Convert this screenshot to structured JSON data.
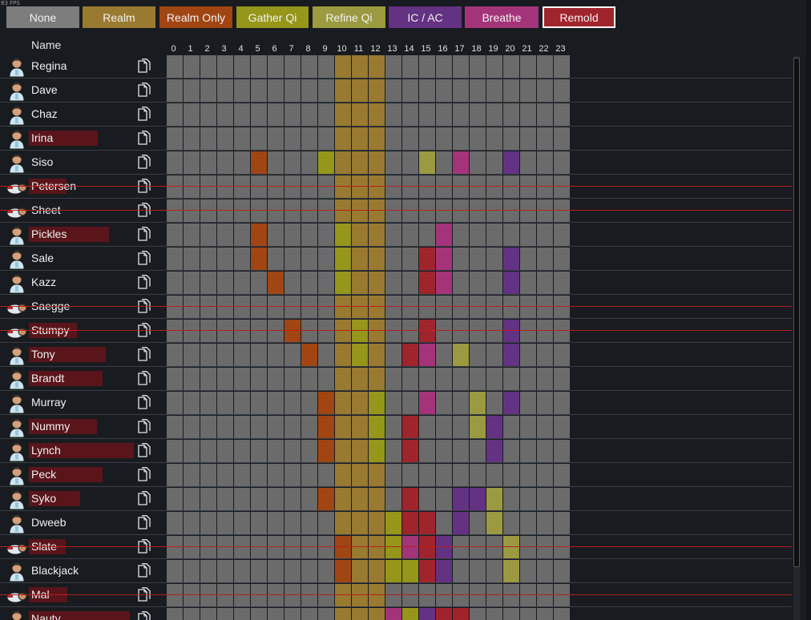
{
  "fps": "83 FPS",
  "modes": [
    {
      "key": "none",
      "label": "None",
      "color": "#7d7d7d"
    },
    {
      "key": "realm",
      "label": "Realm",
      "color": "#9a7a30"
    },
    {
      "key": "realm_only",
      "label": "Realm Only",
      "color": "#a14612"
    },
    {
      "key": "gather_qi",
      "label": "Gather Qi",
      "color": "#96961a"
    },
    {
      "key": "refine_qi",
      "label": "Refine Qi",
      "color": "#9b9a40"
    },
    {
      "key": "ic_ac",
      "label": "IC / AC",
      "color": "#643282"
    },
    {
      "key": "breathe",
      "label": "Breathe",
      "color": "#a4347a"
    },
    {
      "key": "remold",
      "label": "Remold",
      "color": "#a0242c"
    }
  ],
  "selected_mode": "Remold",
  "name_header": "Name",
  "hours": [
    "0",
    "1",
    "2",
    "3",
    "4",
    "5",
    "6",
    "7",
    "8",
    "9",
    "10",
    "11",
    "12",
    "13",
    "14",
    "15",
    "16",
    "17",
    "18",
    "19",
    "20",
    "21",
    "22",
    "23"
  ],
  "colors": {
    "none": "#6b6b6b",
    "realm": "#9a7a30",
    "realm_only": "#a14612",
    "gather_qi": "#96961a",
    "refine_qi": "#9b9a40",
    "ic_ac": "#643282",
    "breathe": "#a4347a",
    "remold": "#a0242c"
  },
  "legend_codes": {
    "n": "none",
    "R": "realm",
    "O": "realm_only",
    "G": "gather_qi",
    "F": "refine_qi",
    "I": "ic_ac",
    "B": "breathe",
    "M": "remold"
  },
  "pawns": [
    {
      "name": "Regina",
      "highlight": 0,
      "downed": false,
      "schedule": "nnnnnnnnnnRRRnnnnnnnnnnn"
    },
    {
      "name": "Dave",
      "highlight": 0,
      "downed": false,
      "schedule": "nnnnnnnnnnRRRnnnnnnnnnnn"
    },
    {
      "name": "Chaz",
      "highlight": 0,
      "downed": false,
      "schedule": "nnnnnnnnnnRRRnnnnnnnnnnn"
    },
    {
      "name": "Irina",
      "highlight": 0.66,
      "downed": false,
      "schedule": "nnnnnnnnnnRRRnnnnnnnnnnn"
    },
    {
      "name": "Siso",
      "highlight": 0,
      "downed": false,
      "schedule": "nnnnnOnnnGRRRnnFnBnnInnn"
    },
    {
      "name": "Petersen",
      "highlight": 0.36,
      "downed": true,
      "schedule": "nnnnnnnnnnRRRnnnnnnnnnnn"
    },
    {
      "name": "Sheet",
      "highlight": 0,
      "downed": true,
      "schedule": "nnnnnnnnnnRRRnnnnnnnnnnn"
    },
    {
      "name": "Pickles",
      "highlight": 0.76,
      "downed": false,
      "schedule": "nnnnnOnnnnGRRnnnBnnnnnnn"
    },
    {
      "name": "Sale",
      "highlight": 0,
      "downed": false,
      "schedule": "nnnnnOnnnnGRRnnMBnnnInnn"
    },
    {
      "name": "Kazz",
      "highlight": 0,
      "downed": false,
      "schedule": "nnnnnnOnnnGRRnnMBnnnInnn"
    },
    {
      "name": "Saegge",
      "highlight": 0,
      "downed": true,
      "schedule": "nnnnnnnnnnRRRnnnnnnnnnnn"
    },
    {
      "name": "Stumpy",
      "highlight": 0.46,
      "downed": true,
      "schedule": "nnnnnnnOnnRGRnnMnnnnInnn"
    },
    {
      "name": "Tony",
      "highlight": 0.73,
      "downed": false,
      "schedule": "nnnnnnnnOnRGRnMBnFnnInnn"
    },
    {
      "name": "Brandt",
      "highlight": 0.7,
      "downed": false,
      "schedule": "nnnnnnnnnnRRRnnnnnnnnnnn"
    },
    {
      "name": "Murray",
      "highlight": 0,
      "downed": false,
      "schedule": "nnnnnnnnnORRGnnBnnFnInnn"
    },
    {
      "name": "Nummy",
      "highlight": 0.65,
      "downed": false,
      "schedule": "nnnnnnnnnORRGnMnnnFInnnn"
    },
    {
      "name": "Lynch",
      "highlight": 1,
      "downed": false,
      "schedule": "nnnnnnnnnORRGnMnnnnInnnn"
    },
    {
      "name": "Peck",
      "highlight": 0.7,
      "downed": false,
      "schedule": "nnnnnnnnnnRRRnnnnnnnnnnn"
    },
    {
      "name": "Syko",
      "highlight": 0.49,
      "downed": false,
      "schedule": "nnnnnnnnnORRRnMnnIIFnnnn"
    },
    {
      "name": "Dweeb",
      "highlight": 0,
      "downed": false,
      "schedule": "nnnnnnnnnnRRRGMMnInFnnnn"
    },
    {
      "name": "Slate",
      "highlight": 0.35,
      "downed": true,
      "schedule": "nnnnnnnnnnORRGBMInnnFnnn"
    },
    {
      "name": "Blackjack",
      "highlight": 0,
      "downed": false,
      "schedule": "nnnnnnnnnnORRGGMInnnFnnn"
    },
    {
      "name": "Mal",
      "highlight": 0.37,
      "downed": true,
      "schedule": "nnnnnnnnnnRRRnnnnnnnnnnn"
    },
    {
      "name": "Nauty",
      "highlight": 0.96,
      "downed": false,
      "schedule": "nnnnnnnnnnRRRBGIMMnnnnnn"
    }
  ]
}
